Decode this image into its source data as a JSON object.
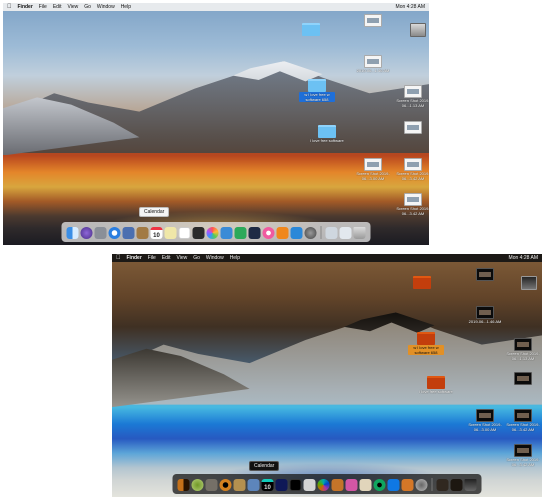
{
  "menubar": {
    "items": [
      "Finder",
      "File",
      "Edit",
      "View",
      "Go",
      "Window",
      "Help"
    ],
    "clock": "Mon 4:28 AM"
  },
  "desktop": {
    "folder_selected_label": "w l love free w software 658",
    "folder_second_label": "l love free software",
    "screenshot_label_1": "2019-06...1.46 AM",
    "screenshot_label_2": "Screen Shot 2019-06...1.13 AM",
    "screenshot_label_3": "Screen Shot 2019-06...3.00 AM",
    "screenshot_label_4": "Screen Shot 2019-06...3.42 AM",
    "screenshot_label_5": "Screen Shot 2019-06...3.42 AM"
  },
  "dock": {
    "tooltip": "Calendar",
    "calendar_date": "10"
  },
  "colors": {
    "normal_folder": "#6cc1f3",
    "inverted_folder": "#c33e0c",
    "selection": "#1e6fd9",
    "inverted_selection": "#e29026"
  },
  "icons": [
    "apple-icon",
    "folder-icon",
    "screenshot-file-icon",
    "hard-drive-icon",
    "finder-icon",
    "launchpad-icon",
    "safari-icon",
    "calendar-icon",
    "trash-icon"
  ]
}
